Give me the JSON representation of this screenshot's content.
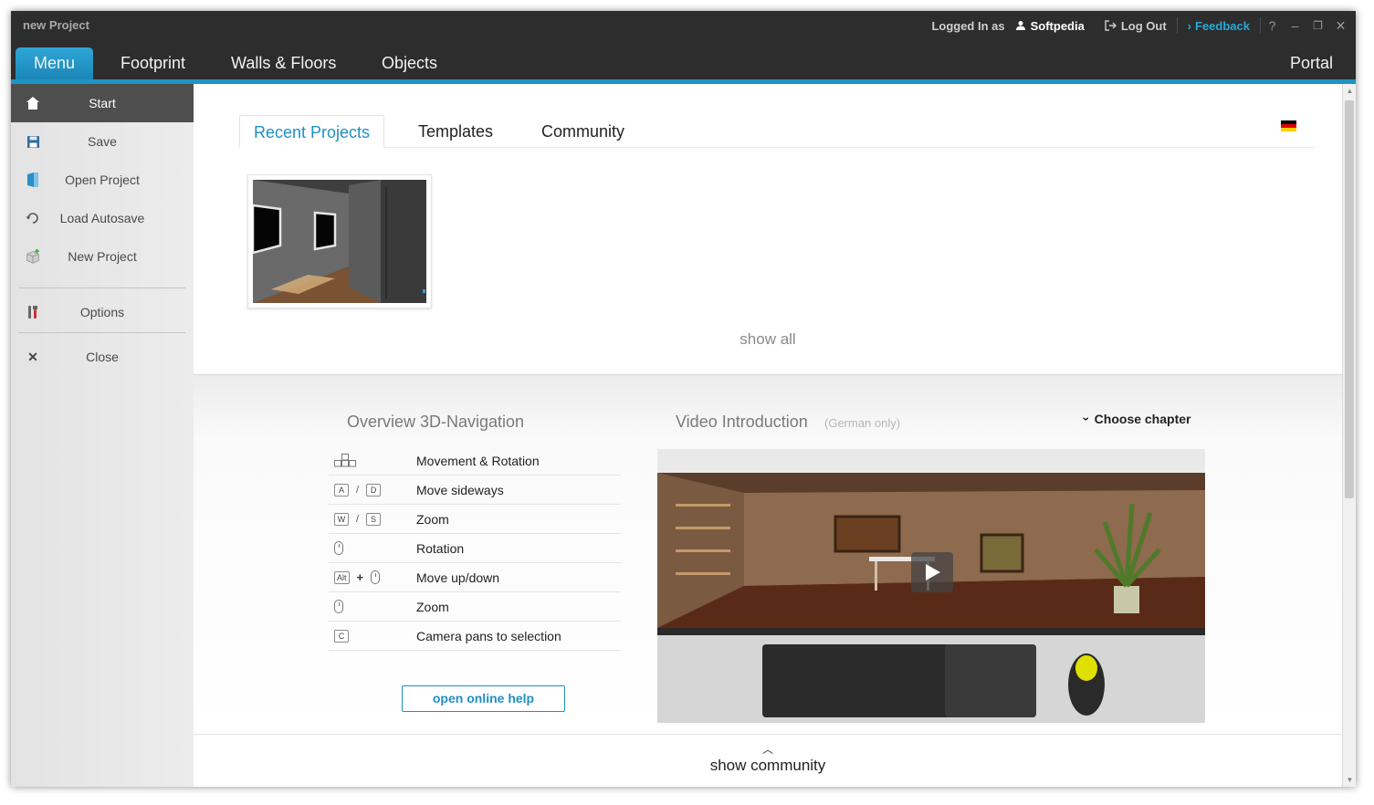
{
  "window": {
    "title": "new Project"
  },
  "titlebar": {
    "logged_in_label": "Logged In as",
    "user_name": "Softpedia",
    "logout_label": "Log Out",
    "feedback_label": "Feedback",
    "help_label": "?",
    "minimize_label": "–",
    "maximize_label": "❐",
    "close_label": "✕"
  },
  "nav": {
    "tabs": [
      {
        "label": "Menu",
        "active": true
      },
      {
        "label": "Footprint"
      },
      {
        "label": "Walls & Floors"
      },
      {
        "label": "Objects"
      }
    ],
    "portal_label": "Portal"
  },
  "sidebar": {
    "items": [
      {
        "label": "Start",
        "icon": "home-icon",
        "active": true
      },
      {
        "label": "Save",
        "icon": "floppy-disk-icon"
      },
      {
        "label": "Open Project",
        "icon": "folder-icon"
      },
      {
        "label": "Load Autosave",
        "icon": "undo-icon"
      },
      {
        "label": "New Project",
        "icon": "new-cube-icon"
      },
      {
        "label": "Options",
        "icon": "tools-icon"
      },
      {
        "label": "Close",
        "icon": "close-x-icon"
      }
    ]
  },
  "main": {
    "tabs": [
      {
        "label": "Recent Projects",
        "active": true
      },
      {
        "label": "Templates"
      },
      {
        "label": "Community"
      }
    ],
    "language_flag": "german-flag-icon",
    "show_all_label": "show all"
  },
  "navigation": {
    "title": "Overview 3D-Navigation",
    "rows": [
      {
        "keys": [
          "arrows"
        ],
        "label": "Movement & Rotation"
      },
      {
        "keys": [
          "A",
          "/",
          "D"
        ],
        "label": "Move sideways"
      },
      {
        "keys": [
          "W",
          "/",
          "S"
        ],
        "label": "Zoom"
      },
      {
        "keys": [
          "mouse"
        ],
        "label": "Rotation"
      },
      {
        "keys": [
          "Alt",
          "+",
          "mouse"
        ],
        "label": "Move up/down"
      },
      {
        "keys": [
          "mouse"
        ],
        "label": "Zoom"
      },
      {
        "keys": [
          "C"
        ],
        "label": "Camera pans to selection"
      }
    ],
    "help_button_label": "open online help"
  },
  "video": {
    "title": "Video Introduction",
    "subtitle": "(German only)",
    "chapter_label": "Choose chapter"
  },
  "footer": {
    "show_community_label": "show community"
  },
  "colors": {
    "accent": "#1f8fc4",
    "titlebar": "#2d2d2d",
    "sidebar": "#e6e6e6"
  }
}
